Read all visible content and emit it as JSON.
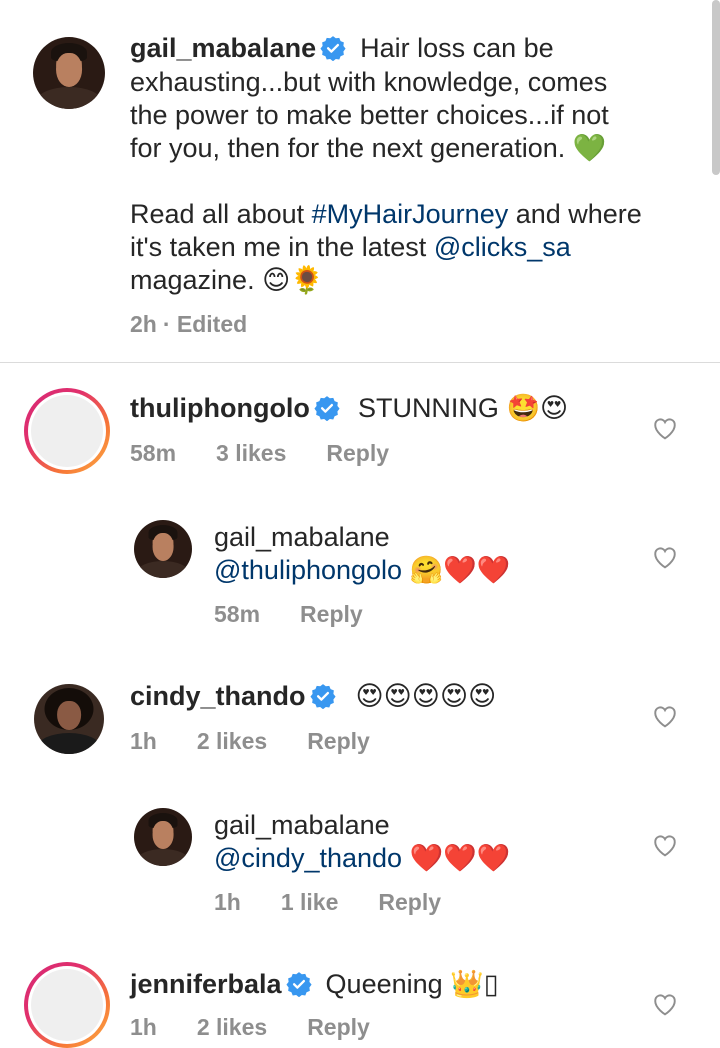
{
  "caption": {
    "username": "gail_mabalane",
    "lines": [
      "Hair loss can be",
      "exhausting...but with knowledge, comes",
      "the power to make better choices...if not",
      "for you, then for the next generation. 💚",
      "Read all about ",
      "#MyHairJourney",
      " and where",
      "it's taken me in the latest ",
      "@clicks_sa",
      "magazine. 😊🌻"
    ],
    "time": "2h",
    "edited": "· Edited"
  },
  "comments": [
    {
      "username": "thuliphongolo",
      "text": "STUNNING 🤩😍",
      "time": "58m",
      "likes": "3 likes",
      "reply": "Reply"
    },
    {
      "username": "gail_mabalane",
      "mention": "@thuliphongolo",
      "text": " 🤗❤️❤️",
      "time": "58m",
      "reply": "Reply"
    },
    {
      "username": "cindy_thando",
      "text": "😍😍😍😍😍",
      "time": "1h",
      "likes": "2 likes",
      "reply": "Reply"
    },
    {
      "username": "gail_mabalane",
      "mention": "@cindy_thando",
      "text": " ❤️❤️❤️",
      "time": "1h",
      "likes": "1 like",
      "reply": "Reply"
    },
    {
      "username": "jenniferbala",
      "text": "Queening 👑▯",
      "time": "1h",
      "likes": "2 likes",
      "reply": "Reply"
    }
  ],
  "colors": {
    "verified": "#3897f0",
    "link": "#00376b",
    "meta": "#8e8e8e",
    "heart_outline": "#8e8e8e"
  },
  "icons": {
    "verified": "verified-badge-icon",
    "like": "heart-outline-icon"
  }
}
